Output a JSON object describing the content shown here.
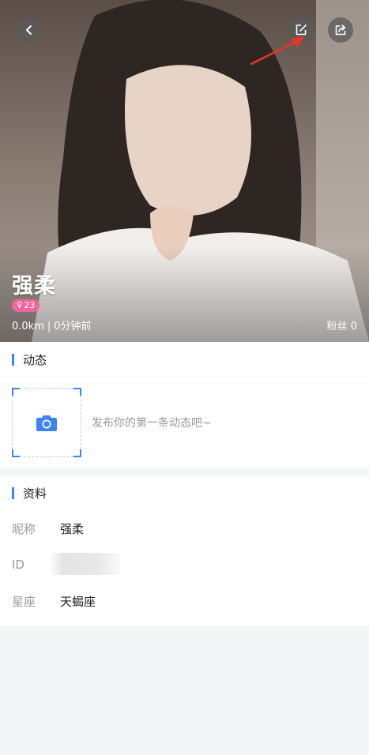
{
  "profile": {
    "name": "强柔",
    "gender_symbol": "♀",
    "age": "23",
    "distance": "0.0km",
    "separator": "|",
    "last_active": "0分钟前",
    "fans": "粉丝 0"
  },
  "moments": {
    "title": "动态",
    "empty_hint": "发布你的第一条动态吧~"
  },
  "info": {
    "title": "资料",
    "rows": [
      {
        "label": "昵称",
        "value": "强柔"
      },
      {
        "label": "ID",
        "value": ""
      },
      {
        "label": "星座",
        "value": "天蝎座"
      }
    ]
  },
  "colors": {
    "accent": "#3b83f6",
    "badge": "#f0669a",
    "annotation_arrow": "#e8332b"
  },
  "icons": {
    "back": "chevron-left-icon",
    "edit": "edit-icon",
    "share": "share-icon",
    "upload": "camera-icon"
  }
}
